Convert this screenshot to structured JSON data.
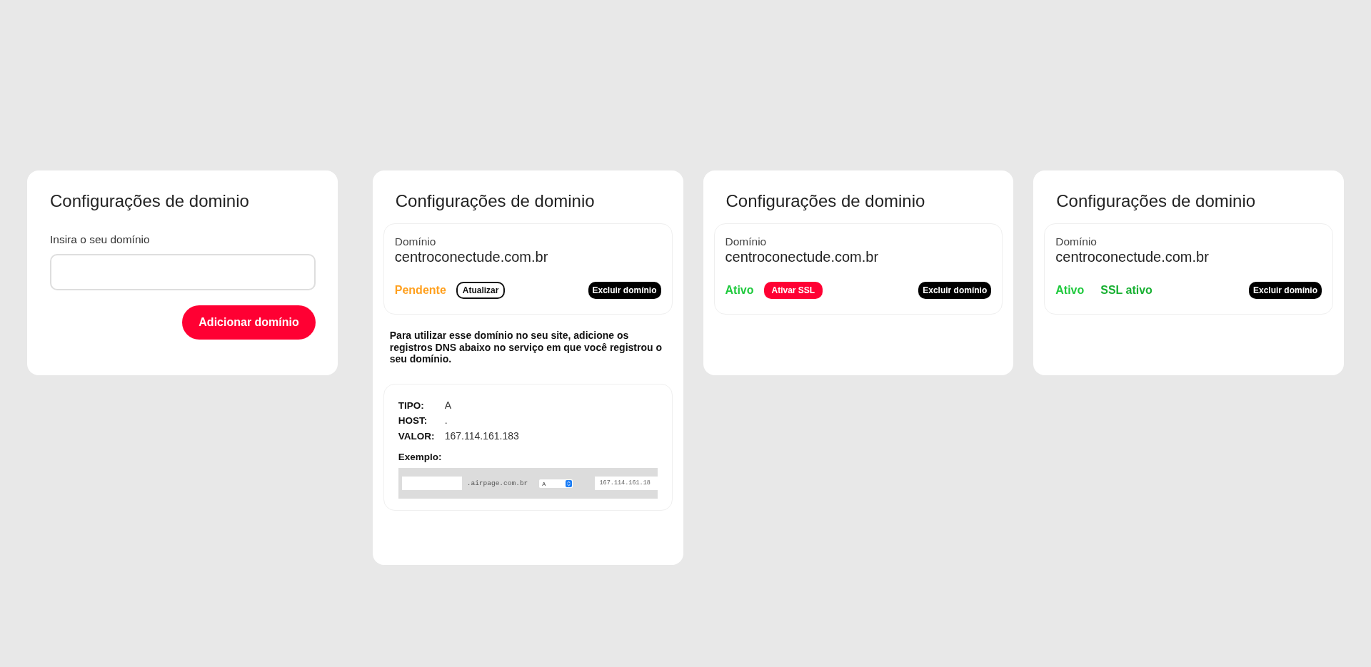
{
  "cards": [
    {
      "kind": "form",
      "title": "Configurações de dominio",
      "field_label": "Insira o seu domínio",
      "submit_button": "Adicionar domínio"
    },
    {
      "kind": "domain",
      "title": "Configurações de dominio",
      "domain_label": "Domínio",
      "domain": "centroconectude.com.br",
      "status_items": [
        {
          "kind": "status",
          "text": "Pendente",
          "color": "#ffa01e"
        },
        {
          "kind": "outline_button",
          "text": "Atualizar"
        }
      ],
      "delete_button": "Excluir domínio",
      "dns_instructions": {
        "text": "Para utilizar esse domínio no seu site, adicione os registros DNS abaixo no serviço em que você registrou o seu domínio.",
        "records": [
          {
            "label": "TIPO:",
            "value": "A"
          },
          {
            "label": "HOST:",
            "value": "."
          },
          {
            "label": "VALOR:",
            "value": "167.114.161.183"
          }
        ],
        "example": {
          "label": "Exemplo:",
          "domain_suffix": ".airpage.com.br",
          "type_select": "A",
          "value": "167.114.161.18"
        }
      }
    },
    {
      "kind": "domain",
      "title": "Configurações de dominio",
      "domain_label": "Domínio",
      "domain": "centroconectude.com.br",
      "status_items": [
        {
          "kind": "status",
          "text": "Ativo",
          "color": "#1ec93c"
        },
        {
          "kind": "filled_button",
          "text": "Ativar SSL"
        }
      ],
      "delete_button": "Excluir domínio"
    },
    {
      "kind": "domain",
      "title": "Configurações de dominio",
      "domain_label": "Domínio",
      "domain": "centroconectude.com.br",
      "status_items": [
        {
          "kind": "status",
          "text": "Ativo",
          "color": "#1ec93c"
        },
        {
          "kind": "status",
          "text": "SSL ativo",
          "color": "#18b032"
        }
      ],
      "delete_button": "Excluir domínio"
    }
  ]
}
